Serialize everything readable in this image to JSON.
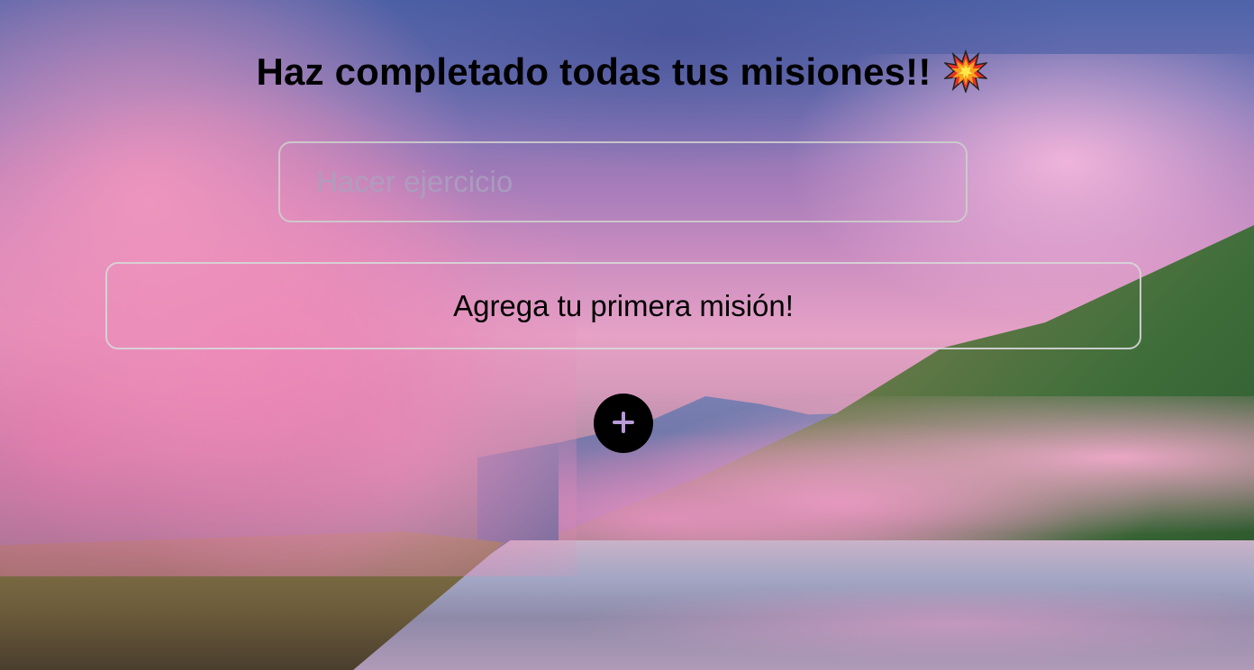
{
  "header": {
    "title": "Haz completado todas tus misiones!!",
    "emoji_icon": "explosion-icon"
  },
  "mission_form": {
    "placeholder": "Hacer ejercicio",
    "value": ""
  },
  "mission_list": {
    "empty_message": "Agrega tu primera misión!"
  },
  "add_button": {
    "icon": "plus-icon",
    "color": "#000000",
    "icon_color": "#b79ad6"
  }
}
